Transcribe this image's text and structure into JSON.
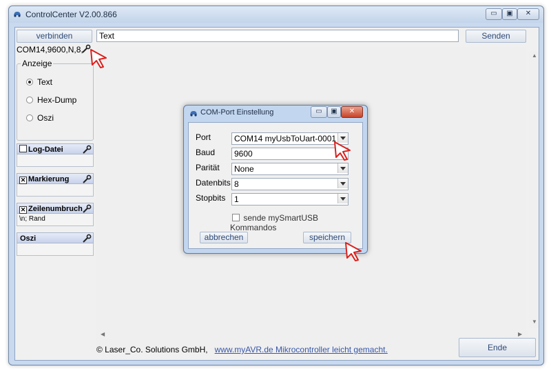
{
  "window": {
    "title": "ControlCenter V2.00.866",
    "controls": [
      "minimize-icon",
      "maximize-icon",
      "close-icon"
    ]
  },
  "toolbar": {
    "connect_label": "verbinden",
    "send_input_value": "Text",
    "send_label": "Senden"
  },
  "port_status": "COM14,9600,N,8,",
  "display_group": {
    "title": "Anzeige",
    "options": [
      {
        "label": "Text",
        "selected": true
      },
      {
        "label": "Hex-Dump",
        "selected": false
      },
      {
        "label": "Oszi",
        "selected": false
      }
    ]
  },
  "panels": [
    {
      "label": "Log-Datei",
      "checked": false,
      "body": ""
    },
    {
      "label": "Markierung",
      "checked": true,
      "body": ""
    },
    {
      "label": "Zeilenumbruch",
      "checked": true,
      "body": "\\n; Rand"
    },
    {
      "label": "Oszi",
      "checked": null,
      "body": ""
    }
  ],
  "footer": {
    "copyright": "© Laser_Co. Solutions GmbH,",
    "link": "www.myAVR.de Mikrocontroller leicht gemacht.",
    "end_label": "Ende"
  },
  "dialog": {
    "title": "COM-Port Einstellung",
    "fields": [
      {
        "label": "Port",
        "value": "COM14    myUsbToUart-0001",
        "dropdown": true
      },
      {
        "label": "Baud",
        "value": "9600",
        "dropdown": false
      },
      {
        "label": "Parität",
        "value": "None",
        "dropdown": true
      },
      {
        "label": "Datenbits",
        "value": "8",
        "dropdown": true
      },
      {
        "label": "Stopbits",
        "value": "1",
        "dropdown": true
      }
    ],
    "checkbox_label": "sende mySmartUSB Kommandos",
    "checkbox_checked": false,
    "cancel_label": "abbrechen",
    "save_label": "speichern"
  },
  "colors": {
    "accent_cursor": "#d9211e",
    "link": "#3756a8",
    "button_text": "#2e4a78"
  }
}
